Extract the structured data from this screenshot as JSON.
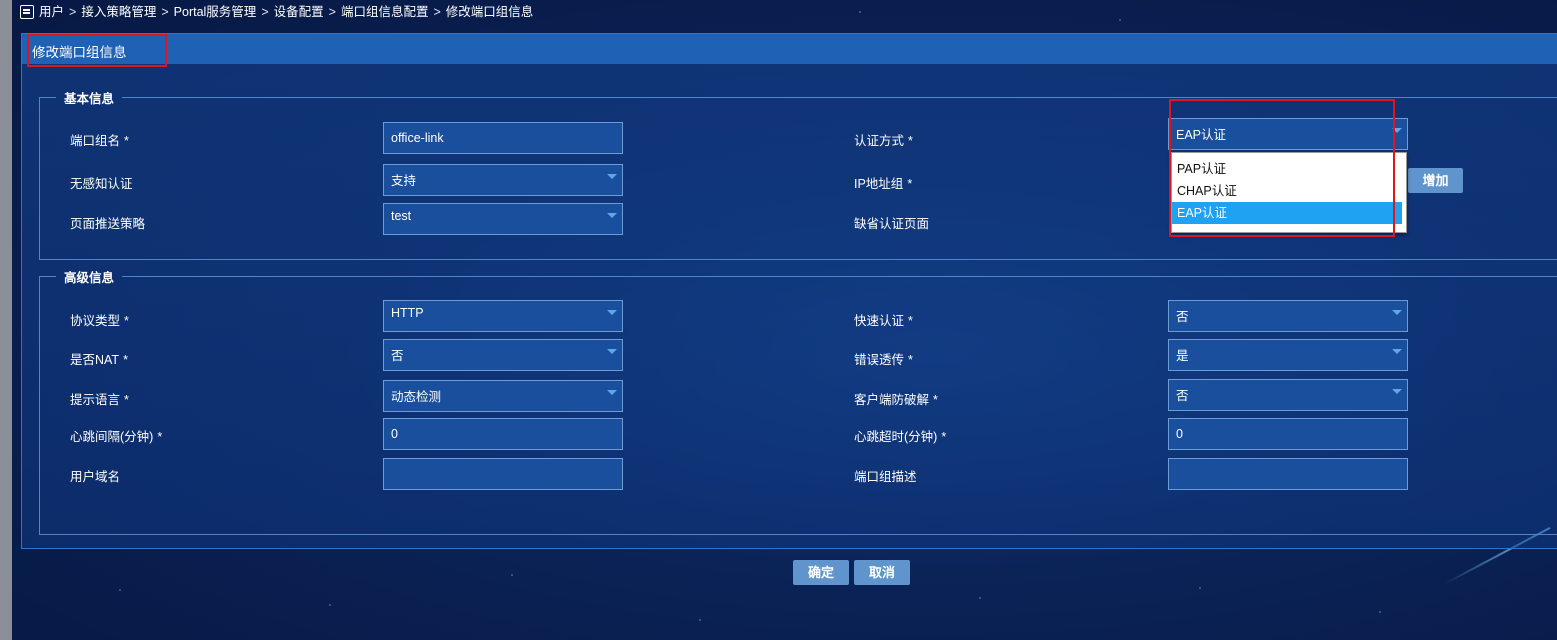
{
  "breadcrumb": {
    "items": [
      "用户",
      "接入策略管理",
      "Portal服务管理",
      "设备配置",
      "端口组信息配置",
      "修改端口组信息"
    ],
    "separator": ">"
  },
  "panel": {
    "title": "修改端口组信息"
  },
  "basic": {
    "legend": "基本信息",
    "port_group_name": {
      "label": "端口组名",
      "value": "office-link"
    },
    "auth_method": {
      "label": "认证方式",
      "value": "EAP认证"
    },
    "seamless_auth": {
      "label": "无感知认证",
      "value": "支持"
    },
    "ip_group": {
      "label": "IP地址组",
      "add_button": "增加"
    },
    "push_policy": {
      "label": "页面推送策略",
      "value": "test"
    },
    "default_page": {
      "label": "缺省认证页面"
    }
  },
  "auth_dropdown": {
    "options": [
      "PAP认证",
      "CHAP认证",
      "EAP认证"
    ],
    "selected": "EAP认证"
  },
  "advanced": {
    "legend": "高级信息",
    "protocol": {
      "label": "协议类型",
      "value": "HTTP"
    },
    "fast_auth": {
      "label": "快速认证",
      "value": "否"
    },
    "nat": {
      "label": "是否NAT",
      "value": "否"
    },
    "error_passthrough": {
      "label": "错误透传",
      "value": "是"
    },
    "language": {
      "label": "提示语言",
      "value": "动态检测"
    },
    "anti_crack": {
      "label": "客户端防破解",
      "value": "否"
    },
    "heartbeat_interval": {
      "label": "心跳间隔(分钟)",
      "value": "0"
    },
    "heartbeat_timeout": {
      "label": "心跳超时(分钟)",
      "value": "0"
    },
    "user_domain": {
      "label": "用户域名",
      "value": ""
    },
    "description": {
      "label": "端口组描述",
      "value": ""
    }
  },
  "required_mark": "*",
  "actions": {
    "confirm": "确定",
    "cancel": "取消"
  },
  "colors": {
    "highlight_border": "#e0161d",
    "dropdown_selected": "#1ea2f1",
    "button": "#5f95cc"
  }
}
